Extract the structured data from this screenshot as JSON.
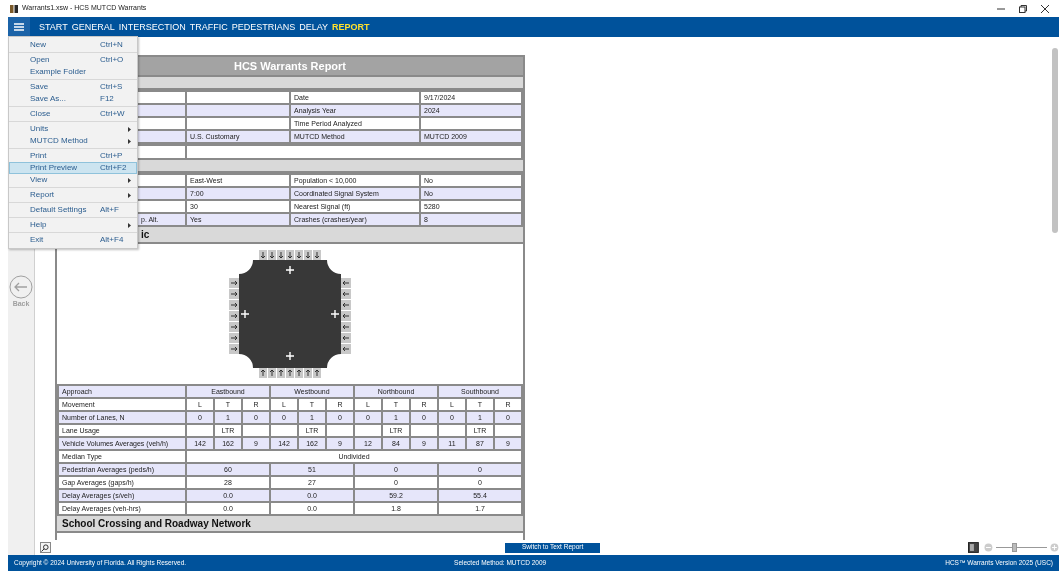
{
  "window": {
    "title": "Warrants1.xsw - HCS MUTCD Warrants"
  },
  "nav": [
    {
      "label": "START",
      "selected": false
    },
    {
      "label": "GENERAL",
      "selected": false
    },
    {
      "label": "INTERSECTION",
      "selected": false
    },
    {
      "label": "TRAFFIC",
      "selected": false
    },
    {
      "label": "PEDESTRIANS",
      "selected": false
    },
    {
      "label": "DELAY",
      "selected": false
    },
    {
      "label": "REPORT",
      "selected": true
    }
  ],
  "menu": [
    [
      {
        "label": "New",
        "shortcut": "Ctrl+N",
        "submenu": false,
        "selected": false
      }
    ],
    [
      {
        "label": "Open",
        "shortcut": "Ctrl+O",
        "submenu": false,
        "selected": false
      },
      {
        "label": "Example Folder",
        "submenu": false,
        "selected": false
      }
    ],
    [
      {
        "label": "Save",
        "shortcut": "Ctrl+S",
        "submenu": false,
        "selected": false
      },
      {
        "label": "Save As...",
        "shortcut": "F12",
        "submenu": false,
        "selected": false
      }
    ],
    [
      {
        "label": "Close",
        "shortcut": "Ctrl+W",
        "submenu": false,
        "selected": false
      }
    ],
    [
      {
        "label": "Units",
        "submenu": true,
        "selected": false
      },
      {
        "label": "MUTCD Method",
        "submenu": true,
        "selected": false
      }
    ],
    [
      {
        "label": "Print",
        "shortcut": "Ctrl+P",
        "submenu": false,
        "selected": false
      },
      {
        "label": "Print Preview",
        "shortcut": "Ctrl+F2",
        "submenu": false,
        "selected": true
      },
      {
        "label": "View",
        "submenu": true,
        "selected": false
      }
    ],
    [
      {
        "label": "Report",
        "submenu": true,
        "selected": false
      }
    ],
    [
      {
        "label": "Default Settings",
        "shortcut": "Alt+F",
        "submenu": false,
        "selected": false
      }
    ],
    [
      {
        "label": "Help",
        "submenu": true,
        "selected": false
      }
    ],
    [
      {
        "label": "Exit",
        "shortcut": "Alt+F4",
        "submenu": false,
        "selected": false
      }
    ]
  ],
  "back": {
    "label": "Back"
  },
  "report": {
    "title": "HCS Warrants Report",
    "general_rows": [
      [
        "",
        "",
        "Date",
        "9/17/2024"
      ],
      [
        "",
        "",
        "Analysis Year",
        "2024"
      ],
      [
        "",
        "",
        "Time Period Analyzed",
        ""
      ],
      [
        "",
        "U.S. Customary",
        "MUTCD Method",
        "MUTCD 2009"
      ]
    ],
    "site_rows": [
      [
        "",
        "East-West",
        "Population < 10,000",
        "No"
      ],
      [
        "",
        "7:00",
        "Coordinated Signal System",
        "No"
      ],
      [
        "",
        "30",
        "Nearest Signal (ft)",
        "5280"
      ],
      [
        "p. Alt.",
        "Yes",
        "Crashes (crashes/year)",
        "8"
      ]
    ],
    "traffic_heading": "ic",
    "traffic_rows": [
      {
        "kind": "approach",
        "label": "Approach",
        "cells": [
          "Eastbound",
          "Westbound",
          "Northbound",
          "Southbound"
        ]
      },
      {
        "kind": "movement",
        "label": "Movement",
        "cells": [
          "L",
          "T",
          "R",
          "L",
          "T",
          "R",
          "L",
          "T",
          "R",
          "L",
          "T",
          "R"
        ]
      },
      {
        "kind": "movement",
        "label": "Number of Lanes, N",
        "cells": [
          "0",
          "1",
          "0",
          "0",
          "1",
          "0",
          "0",
          "1",
          "0",
          "0",
          "1",
          "0"
        ]
      },
      {
        "kind": "movement",
        "label": "Lane Usage",
        "cells": [
          "",
          "LTR",
          "",
          "",
          "LTR",
          "",
          "",
          "LTR",
          "",
          "",
          "LTR",
          ""
        ]
      },
      {
        "kind": "movement",
        "label": "Vehicle Volumes Averages (veh/h)",
        "cells": [
          "142",
          "162",
          "9",
          "142",
          "162",
          "9",
          "12",
          "84",
          "9",
          "11",
          "87",
          "9"
        ]
      },
      {
        "kind": "whole",
        "label": "Median Type",
        "cells": [
          "Undivided"
        ]
      },
      {
        "kind": "approach",
        "label": "Pedestrian Averages (peds/h)",
        "cells": [
          "60",
          "51",
          "0",
          "0"
        ]
      },
      {
        "kind": "approach",
        "label": "Gap Averages (gaps/h)",
        "cells": [
          "28",
          "27",
          "0",
          "0"
        ]
      },
      {
        "kind": "approach",
        "label": "Delay Averages (s/veh)",
        "cells": [
          "0.0",
          "0.0",
          "59.2",
          "55.4"
        ]
      },
      {
        "kind": "approach",
        "label": "Delay Averages (veh-hrs)",
        "cells": [
          "0.0",
          "0.0",
          "1.8",
          "1.7"
        ]
      }
    ],
    "school_heading": "School Crossing and Roadway Network"
  },
  "switch_button": "Switch to Text Report",
  "zoom": {
    "level": 0.36
  },
  "status_bar": {
    "copyright": "Copyright © 2024 University of Florida. All Rights Reserved.",
    "method": "Selected Method: MUTCD 2009",
    "version": "HCS™ Warrants Version 2025 (USC)"
  }
}
